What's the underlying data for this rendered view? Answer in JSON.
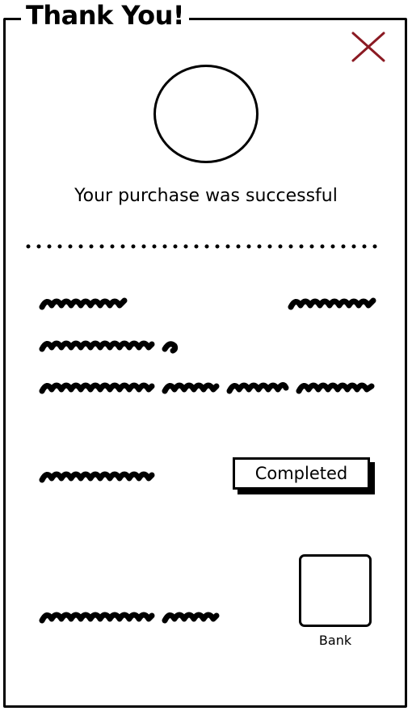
{
  "dialog": {
    "title": "Thank You!",
    "message": "Your purchase was successful"
  },
  "close_icon": "close-icon",
  "status": {
    "label": "Completed"
  },
  "payment": {
    "method_label": "Bank"
  },
  "colors": {
    "close_icon": "#8b1a23",
    "ink": "#000000",
    "background": "#ffffff"
  }
}
